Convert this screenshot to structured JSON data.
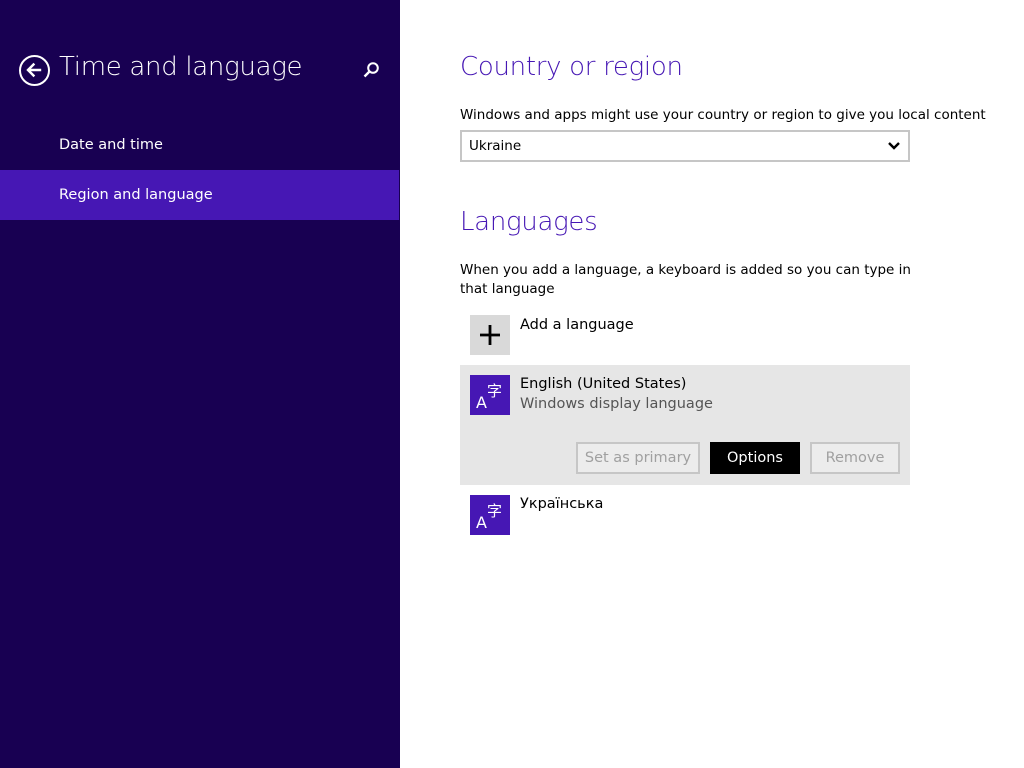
{
  "sidebar": {
    "title": "Time and language",
    "items": [
      {
        "label": "Date and time",
        "selected": false
      },
      {
        "label": "Region and language",
        "selected": true
      }
    ],
    "back_icon": "back-arrow-icon",
    "search_icon": "search-icon"
  },
  "country": {
    "heading": "Country or region",
    "description": "Windows and apps might use your country or region to give you local content",
    "selected": "Ukraine"
  },
  "languages": {
    "heading": "Languages",
    "description": "When you add a language, a keyboard is added so you can type in that language",
    "add_label": "Add a language",
    "items": [
      {
        "name": "English (United States)",
        "subtitle": "Windows display language",
        "selected": true,
        "buttons": {
          "set_primary": "Set as primary",
          "options": "Options",
          "remove": "Remove"
        }
      },
      {
        "name": "Українська",
        "selected": false
      }
    ]
  },
  "colors": {
    "sidebar_bg": "#180052",
    "accent": "#4617b4",
    "selected_row_bg": "#e6e6e6"
  }
}
